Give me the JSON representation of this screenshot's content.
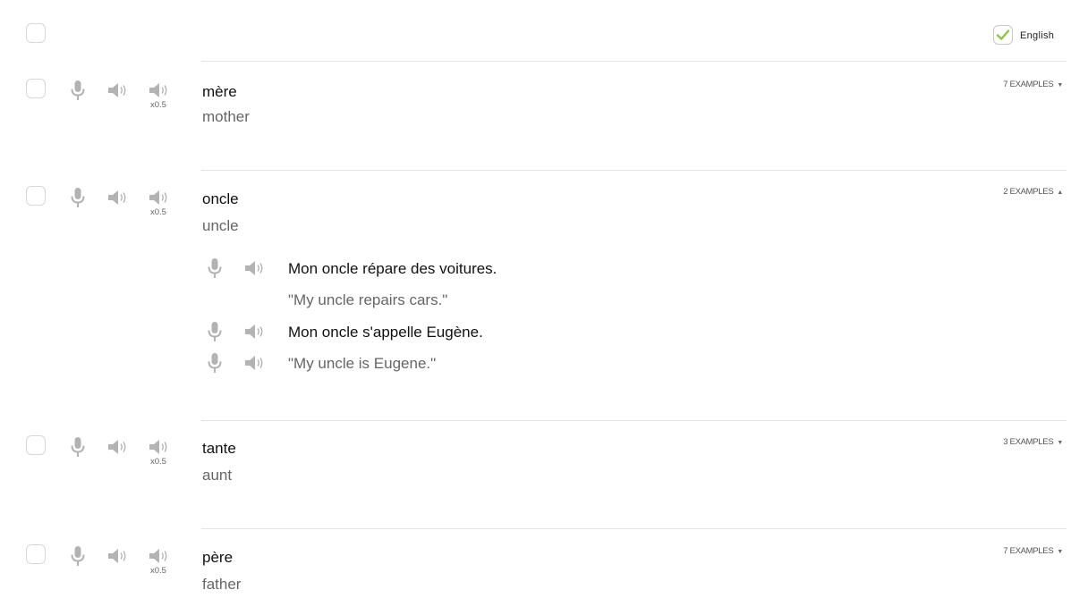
{
  "header": {
    "language_label": "English"
  },
  "entries": [
    {
      "word": "mère",
      "translation": "mother",
      "examples_label": "7 EXAMPLES",
      "slow_label": "x0.5"
    },
    {
      "word": "oncle",
      "translation": "uncle",
      "examples_label": "2 EXAMPLES",
      "slow_label": "x0.5",
      "examples": [
        {
          "text": "Mon oncle répare des voitures.",
          "translation": "\"My uncle repairs cars.\""
        },
        {
          "text": "Mon oncle s'appelle Eugène.",
          "translation": "\"My uncle is Eugene.\""
        }
      ]
    },
    {
      "word": "tante",
      "translation": "aunt",
      "examples_label": "3 EXAMPLES",
      "slow_label": "x0.5"
    },
    {
      "word": "père",
      "translation": "father",
      "examples_label": "7 EXAMPLES",
      "slow_label": "x0.5"
    }
  ],
  "icons": {
    "microphone": "microphone-icon",
    "speaker": "speaker-icon",
    "slow_speaker": "slow-speaker-icon",
    "check": "check-icon",
    "caret": "caret-down-icon"
  },
  "colors": {
    "icon_gray": "#b3b3b3",
    "check_green": "#8cc63f",
    "divider": "#e4e4e4"
  }
}
